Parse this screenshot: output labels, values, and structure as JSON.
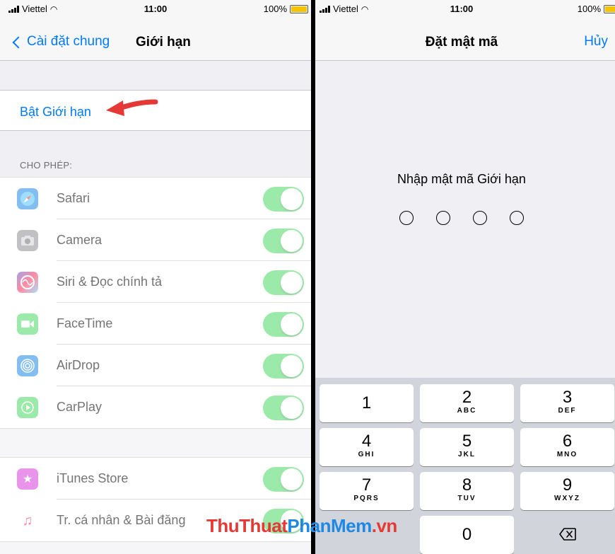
{
  "left_screen": {
    "status_bar": {
      "carrier": "Viettel",
      "time": "11:00",
      "battery": "100%"
    },
    "nav": {
      "back_label": "Cài đặt chung",
      "title": "Giới hạn"
    },
    "enable_restrictions_label": "Bật Giới hạn",
    "allow_section_header": "CHO PHÉP:",
    "allow_items": [
      {
        "label": "Safari",
        "icon": "safari-icon",
        "enabled": true
      },
      {
        "label": "Camera",
        "icon": "camera-icon",
        "enabled": true
      },
      {
        "label": "Siri & Đọc chính tả",
        "icon": "siri-icon",
        "enabled": true
      },
      {
        "label": "FaceTime",
        "icon": "facetime-icon",
        "enabled": true
      },
      {
        "label": "AirDrop",
        "icon": "airdrop-icon",
        "enabled": true
      },
      {
        "label": "CarPlay",
        "icon": "carplay-icon",
        "enabled": true
      }
    ],
    "store_items": [
      {
        "label": "iTunes Store",
        "icon": "itunes-store-icon",
        "enabled": true
      },
      {
        "label": "Tr. cá nhân & Bài đăng",
        "icon": "music-note-icon",
        "enabled": true
      }
    ]
  },
  "right_screen": {
    "status_bar": {
      "carrier": "Viettel",
      "time": "11:00",
      "battery": "100%"
    },
    "nav": {
      "title": "Đặt mật mã",
      "cancel_label": "Hủy"
    },
    "passcode_prompt": "Nhập mật mã Giới hạn",
    "passcode_length": 4,
    "keypad": {
      "keys": [
        {
          "num": "1",
          "letters": ""
        },
        {
          "num": "2",
          "letters": "ABC"
        },
        {
          "num": "3",
          "letters": "DEF"
        },
        {
          "num": "4",
          "letters": "GHI"
        },
        {
          "num": "5",
          "letters": "JKL"
        },
        {
          "num": "6",
          "letters": "MNO"
        },
        {
          "num": "7",
          "letters": "PQRS"
        },
        {
          "num": "8",
          "letters": "TUV"
        },
        {
          "num": "9",
          "letters": "WXYZ"
        },
        {
          "num": "0",
          "letters": ""
        }
      ]
    }
  },
  "watermark": {
    "part1": "ThuThuat",
    "part2": "PhanMem",
    "part3": ".vn"
  },
  "colors": {
    "accent": "#007aff",
    "toggle_on": "#4cd964",
    "arrow": "#e53935",
    "battery": "#f6c300"
  }
}
